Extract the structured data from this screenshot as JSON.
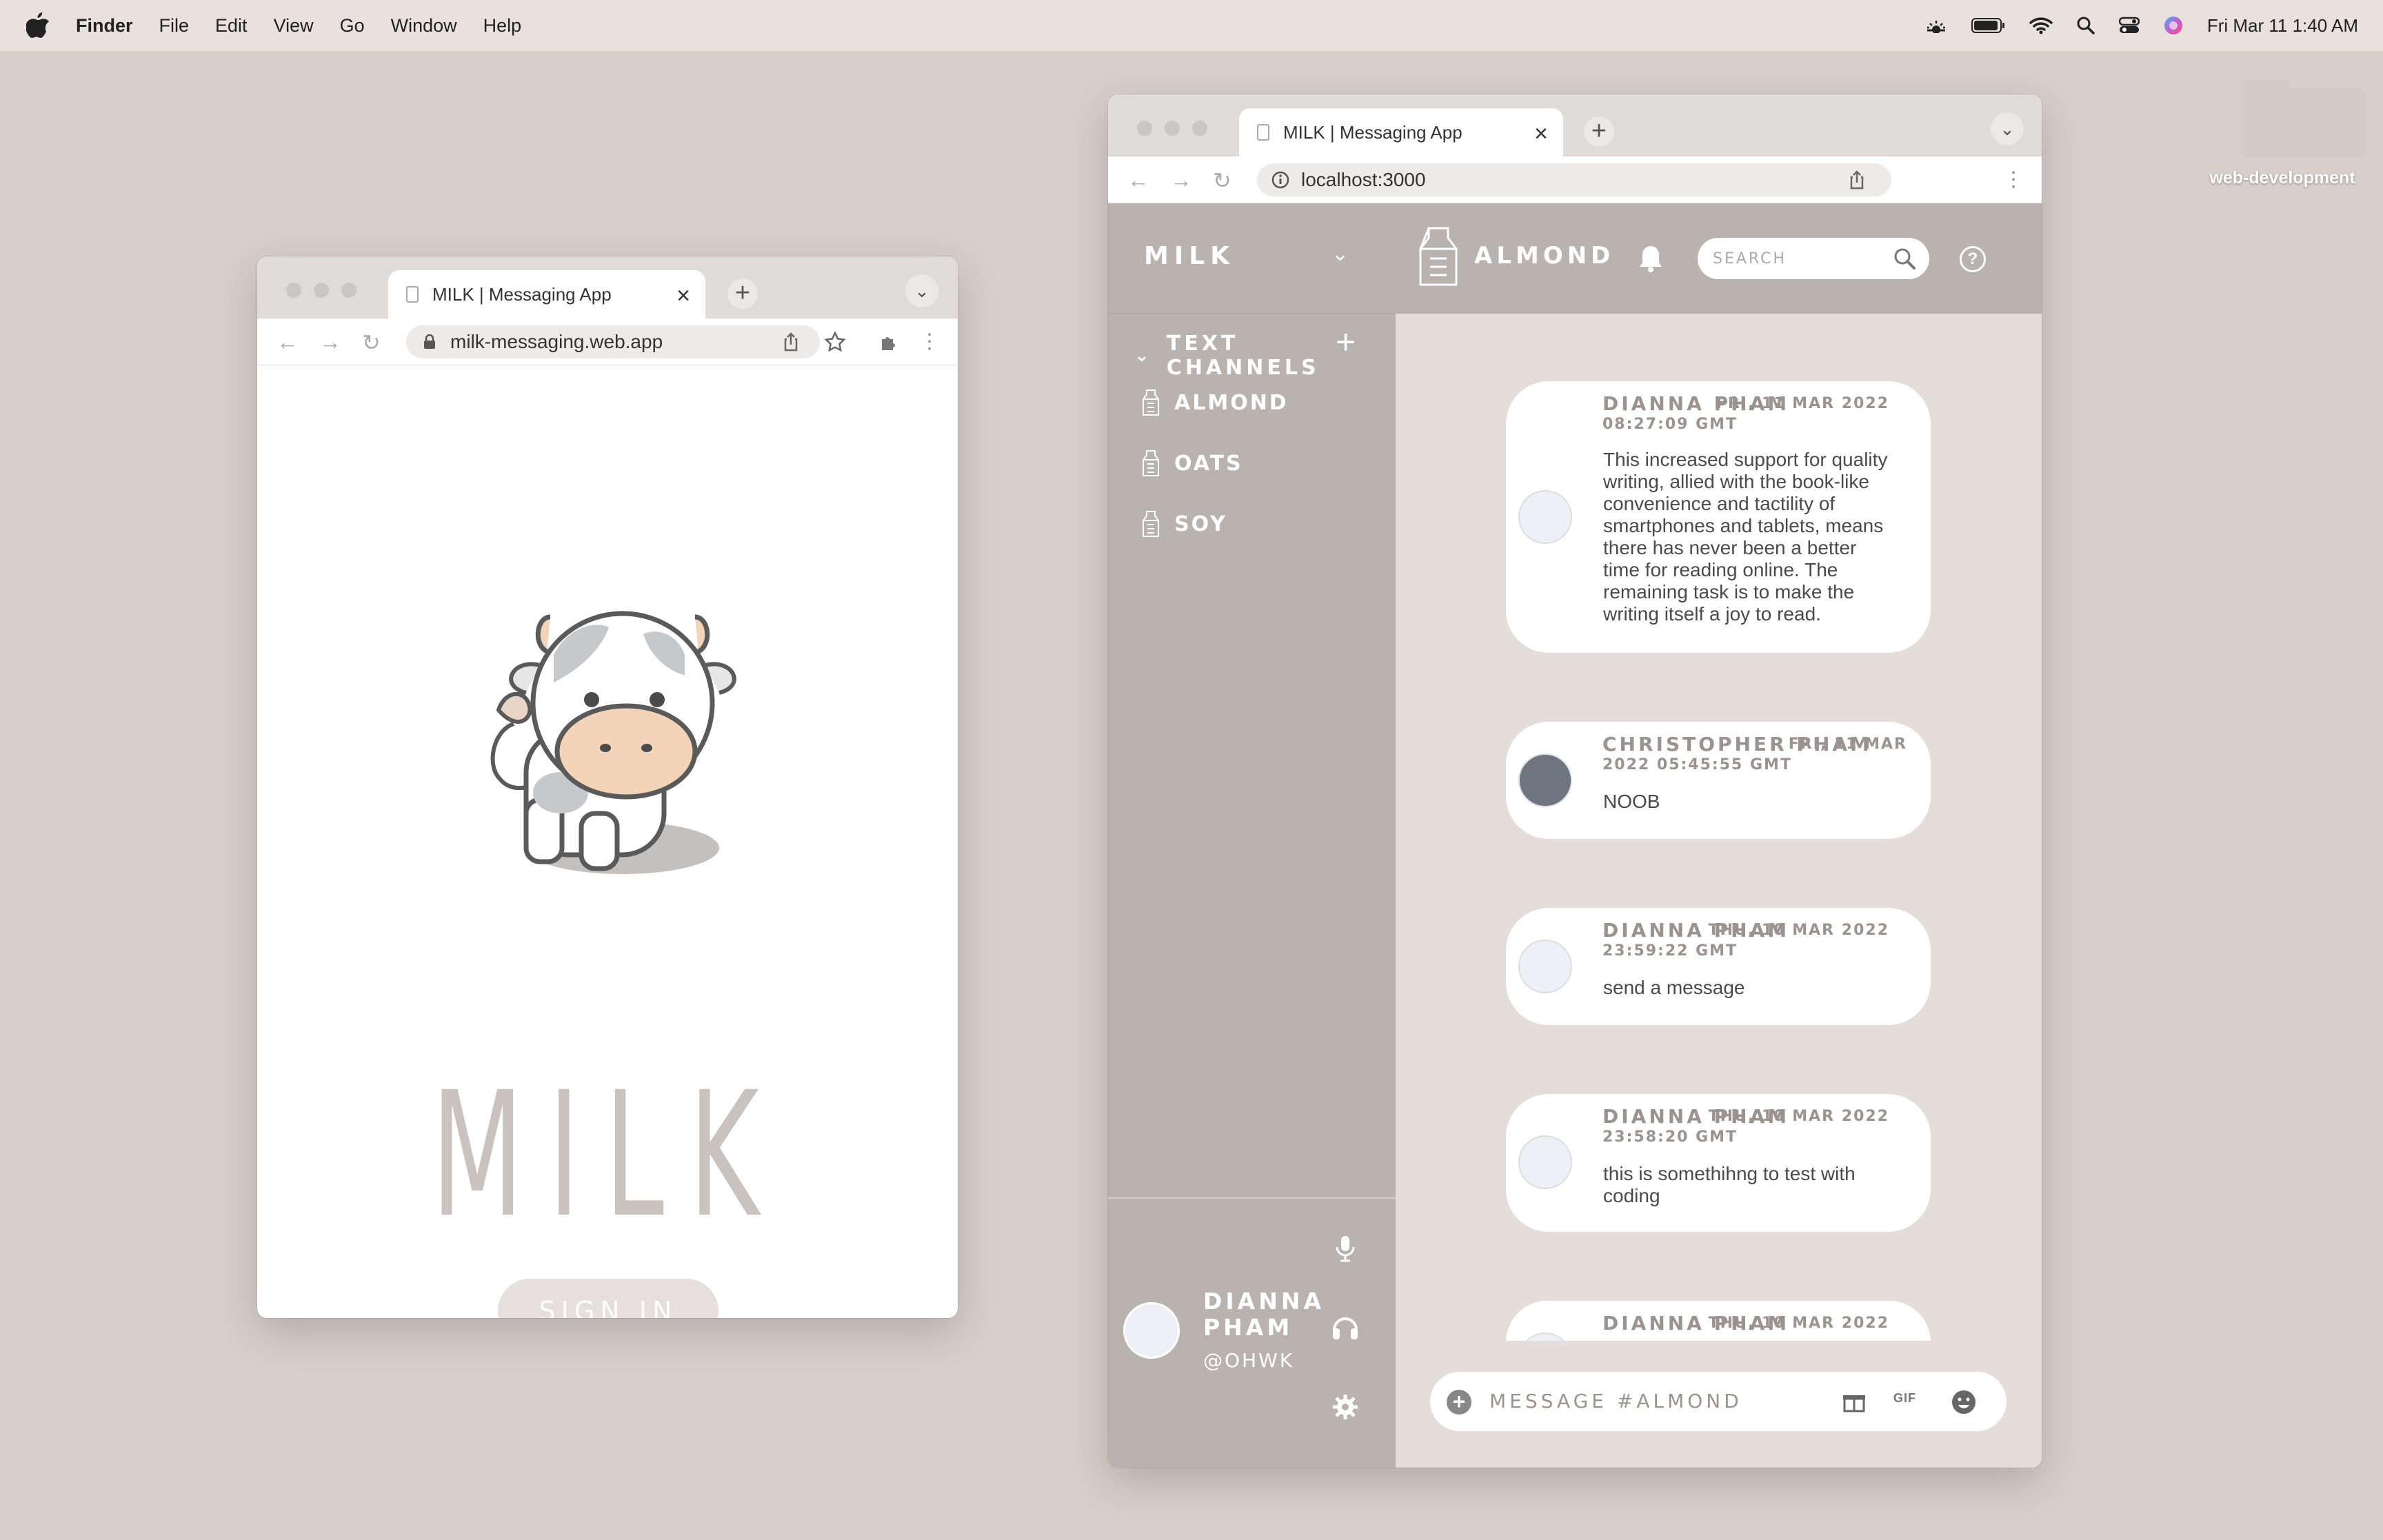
{
  "menubar": {
    "app_name": "Finder",
    "items": [
      "File",
      "Edit",
      "View",
      "Go",
      "Window",
      "Help"
    ],
    "clock": "Fri Mar 11  1:40 AM"
  },
  "desktop": {
    "folder_label": "web-development"
  },
  "left_window": {
    "tab_title": "MILK | Messaging App",
    "url": "milk-messaging.web.app",
    "logo_text": "MILK",
    "signin_label": "SIGN IN"
  },
  "right_window": {
    "tab_title": "MILK | Messaging App",
    "url": "localhost:3000",
    "brand": "MILK",
    "section_title": "TEXT CHANNELS",
    "channels": [
      {
        "label": "ALMOND"
      },
      {
        "label": "OATS"
      },
      {
        "label": "SOY"
      }
    ],
    "current_channel": "ALMOND",
    "search_placeholder": "SEARCH",
    "user": {
      "name": "DIANNA PHAM",
      "handle": "@OHWK"
    },
    "messages": [
      {
        "author": "DIANNA PHAM",
        "date": "FRI, 11 MAR 2022",
        "time": "08:27:09 GMT",
        "text": "This increased support for quality writing, allied with the book-like convenience and tactility of smartphones and tablets, means there has never been a better time for reading online. The remaining task is to make the writing itself a joy to read."
      },
      {
        "author": "CHRISTOPHER PHAM",
        "date": "FRI, 11 MAR",
        "time": "2022 05:45:55 GMT",
        "text": "NOOB"
      },
      {
        "author": "DIANNA PHAM",
        "date": "THU, 10 MAR 2022",
        "time": "23:59:22 GMT",
        "text": "send a message"
      },
      {
        "author": "DIANNA PHAM",
        "date": "THU, 10 MAR 2022",
        "time": "23:58:20 GMT",
        "text": "this is somethihng to test with coding"
      },
      {
        "author": "DIANNA PHAM",
        "date": "THU, 10 MAR 2022",
        "time": "",
        "text": ""
      }
    ],
    "composer_placeholder": "MESSAGE #ALMOND",
    "gif_label": "GIF"
  },
  "colors": {
    "desktop": "#d8cfca",
    "sidebar": "#b9b3b0",
    "feed": "#e4dedb",
    "accent_text": "#9a9390"
  }
}
